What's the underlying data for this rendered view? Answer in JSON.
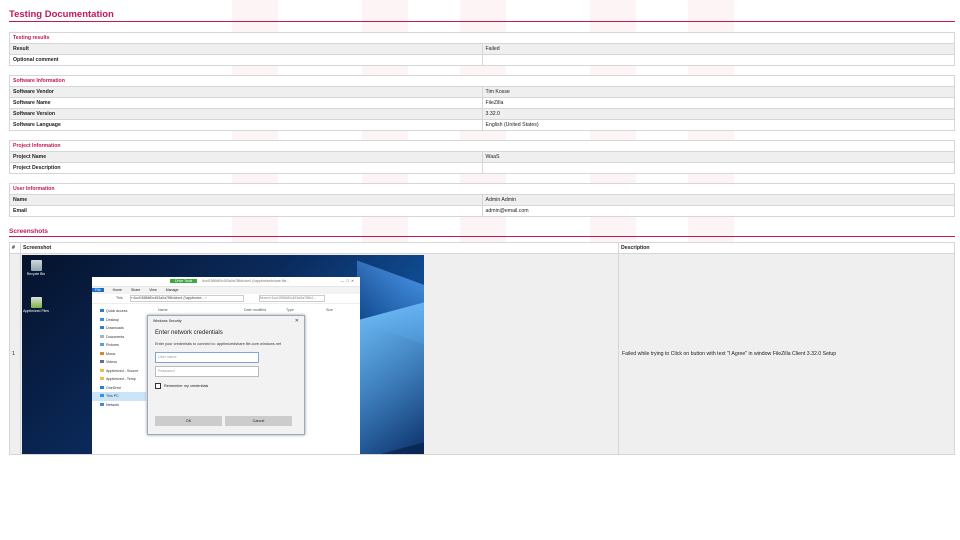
{
  "doc": {
    "title": "Testing Documentation"
  },
  "testing": {
    "heading": "Testing results",
    "rows": [
      {
        "key": "Result",
        "value": "Failed"
      },
      {
        "key": "Optional comment",
        "value": ""
      }
    ]
  },
  "software": {
    "heading": "Software Information",
    "rows": [
      {
        "key": "Software Vendor",
        "value": "Tim Kosse"
      },
      {
        "key": "Software Name",
        "value": "FileZilla"
      },
      {
        "key": "Software Version",
        "value": "3.32.0"
      },
      {
        "key": "Software Language",
        "value": "English (United States)"
      }
    ]
  },
  "project": {
    "heading": "Project Information",
    "rows": [
      {
        "key": "Project Name",
        "value": "WaaS"
      },
      {
        "key": "Project Description",
        "value": ""
      }
    ]
  },
  "user": {
    "heading": "User Information",
    "rows": [
      {
        "key": "Name",
        "value": "Admin Admin"
      },
      {
        "key": "Email",
        "value": "admin@email.com"
      }
    ]
  },
  "screenshots": {
    "heading": "Screenshots",
    "col_num": "#",
    "col_shot": "Screenshot",
    "col_desc": "Description",
    "rows": [
      {
        "num": "1",
        "description": "Failed while trying to Click on button with text \"I Agree\" in window FileZilla Client 3.32.0 Setup"
      }
    ]
  },
  "shot": {
    "desktop_icons": [
      "Recycle Bin",
      "Apptimized Files"
    ],
    "explorer": {
      "tool_tab": "Drive Tools",
      "title_path": "6ccf15866f0c453a0a7f8b4cbe4 (\\\\apptimizedshare.file...",
      "ribbon": [
        "File",
        "Home",
        "Share",
        "View",
        "Manage"
      ],
      "address": "« 6ccf15866f0c453a0a7f8b4cbe4 (\\\\apptimize... ›",
      "address_label": "This",
      "search": "Search 6ccf15866f0c453a0a7f8b4...",
      "columns": [
        "Name",
        "Date modified",
        "Type",
        "Size"
      ],
      "nav": [
        "Quick access",
        "Desktop",
        "Downloads",
        "Documents",
        "Pictures",
        "Music",
        "Videos",
        "Apptimized - Source",
        "Apptimized - Temp",
        "OneDrive",
        "This PC",
        "Network"
      ]
    },
    "dialog": {
      "title": "Windows Security",
      "heading": "Enter network credentials",
      "prompt": "Enter your credentials to connect to: apptimizedshare.file.core.windows.net",
      "user_placeholder": "User name",
      "pass_placeholder": "Password",
      "remember": "Remember my credentials",
      "ok": "OK",
      "cancel": "Cancel"
    }
  },
  "colors": {
    "accent": "#c2185b",
    "row_alt": "#efefef",
    "border": "#d6d6d6"
  }
}
